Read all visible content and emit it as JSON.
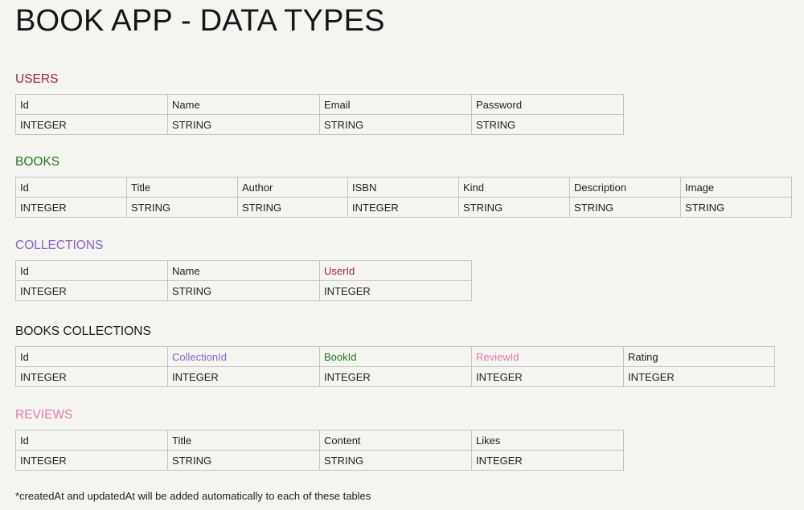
{
  "title": "BOOK APP - DATA TYPES",
  "colors": {
    "users": "#a81e3e",
    "books": "#1c7a1c",
    "collections": "#8a63c6",
    "books_collections": "#1a1a1a",
    "reviews": "#e879ad"
  },
  "tables": {
    "users": {
      "title": "USERS",
      "columns": [
        "Id",
        "Name",
        "Email",
        "Password"
      ],
      "types": [
        "INTEGER",
        "STRING",
        "STRING",
        "STRING"
      ]
    },
    "books": {
      "title": "BOOKS",
      "columns": [
        "Id",
        "Title",
        "Author",
        "ISBN",
        "Kind",
        "Description",
        "Image"
      ],
      "types": [
        "INTEGER",
        "STRING",
        "STRING",
        "INTEGER",
        "STRING",
        "STRING",
        "STRING"
      ]
    },
    "collections": {
      "title": "COLLECTIONS",
      "columns": [
        "Id",
        "Name",
        "UserId"
      ],
      "types": [
        "INTEGER",
        "STRING",
        "INTEGER"
      ]
    },
    "books_collections": {
      "title": "BOOKS COLLECTIONS",
      "columns": [
        "Id",
        "CollectionId",
        "BookId",
        "ReviewId",
        "Rating"
      ],
      "types": [
        "INTEGER",
        "INTEGER",
        "INTEGER",
        "INTEGER",
        "INTEGER"
      ]
    },
    "reviews": {
      "title": "REVIEWS",
      "columns": [
        "Id",
        "Title",
        "Content",
        "Likes"
      ],
      "types": [
        "INTEGER",
        "STRING",
        "STRING",
        "INTEGER"
      ]
    }
  },
  "footnote": "*createdAt and updatedAt will be added automatically to each of these tables"
}
